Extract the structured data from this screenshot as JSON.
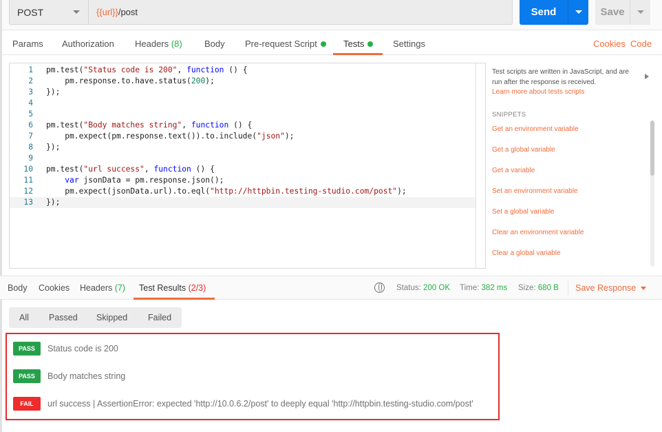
{
  "request": {
    "method": "POST",
    "url_variable": "{{url}}",
    "url_path": "/post",
    "send_label": "Send",
    "save_label": "Save"
  },
  "request_tabs": [
    {
      "label": "Params"
    },
    {
      "label": "Authorization"
    },
    {
      "label": "Headers",
      "count": "(8)"
    },
    {
      "label": "Body"
    },
    {
      "label": "Pre-request Script",
      "has_dot": true
    },
    {
      "label": "Tests",
      "has_dot": true,
      "active": true
    },
    {
      "label": "Settings"
    }
  ],
  "links": {
    "cookies": "Cookies",
    "code": "Code"
  },
  "editor": {
    "cursor_line": 13,
    "lines": [
      "pm.test(\"Status code is 200\", function () {",
      "    pm.response.to.have.status(200);",
      "});",
      "",
      "",
      "pm.test(\"Body matches string\", function () {",
      "    pm.expect(pm.response.text()).to.include(\"json\");",
      "});",
      "",
      "pm.test(\"url success\", function () {",
      "    var jsonData = pm.response.json();",
      "    pm.expect(jsonData.url).to.eql(\"http://httpbin.testing-studio.com/post\");",
      "});"
    ]
  },
  "help": {
    "description": "Test scripts are written in JavaScript, and are run after the response is received.",
    "learn_more": "Learn more about tests scripts",
    "snippets_heading": "SNIPPETS",
    "snippets": [
      "Get an environment variable",
      "Get a global variable",
      "Get a variable",
      "Set an environment variable",
      "Set a global variable",
      "Clear an environment variable",
      "Clear a global variable"
    ]
  },
  "response_tabs": {
    "body": "Body",
    "cookies": "Cookies",
    "headers": "Headers",
    "headers_count": "(7)",
    "test_results": "Test Results",
    "test_results_count": "(2/3)"
  },
  "response_meta": {
    "status_label": "Status:",
    "status": "200 OK",
    "time_label": "Time:",
    "time": "382 ms",
    "size_label": "Size:",
    "size": "680 B",
    "save_response": "Save Response"
  },
  "filters": [
    "All",
    "Passed",
    "Skipped",
    "Failed"
  ],
  "colors": {
    "accent": "#f26b3a",
    "send": "#097bed",
    "pass": "#26a04b",
    "fail": "#ef2b2b"
  },
  "results": [
    {
      "status": "PASS",
      "text": "Status code is 200"
    },
    {
      "status": "PASS",
      "text": "Body matches string"
    },
    {
      "status": "FAIL",
      "text": "url success | AssertionError: expected 'http://10.0.6.2/post' to deeply equal 'http://httpbin.testing-studio.com/post'"
    }
  ]
}
